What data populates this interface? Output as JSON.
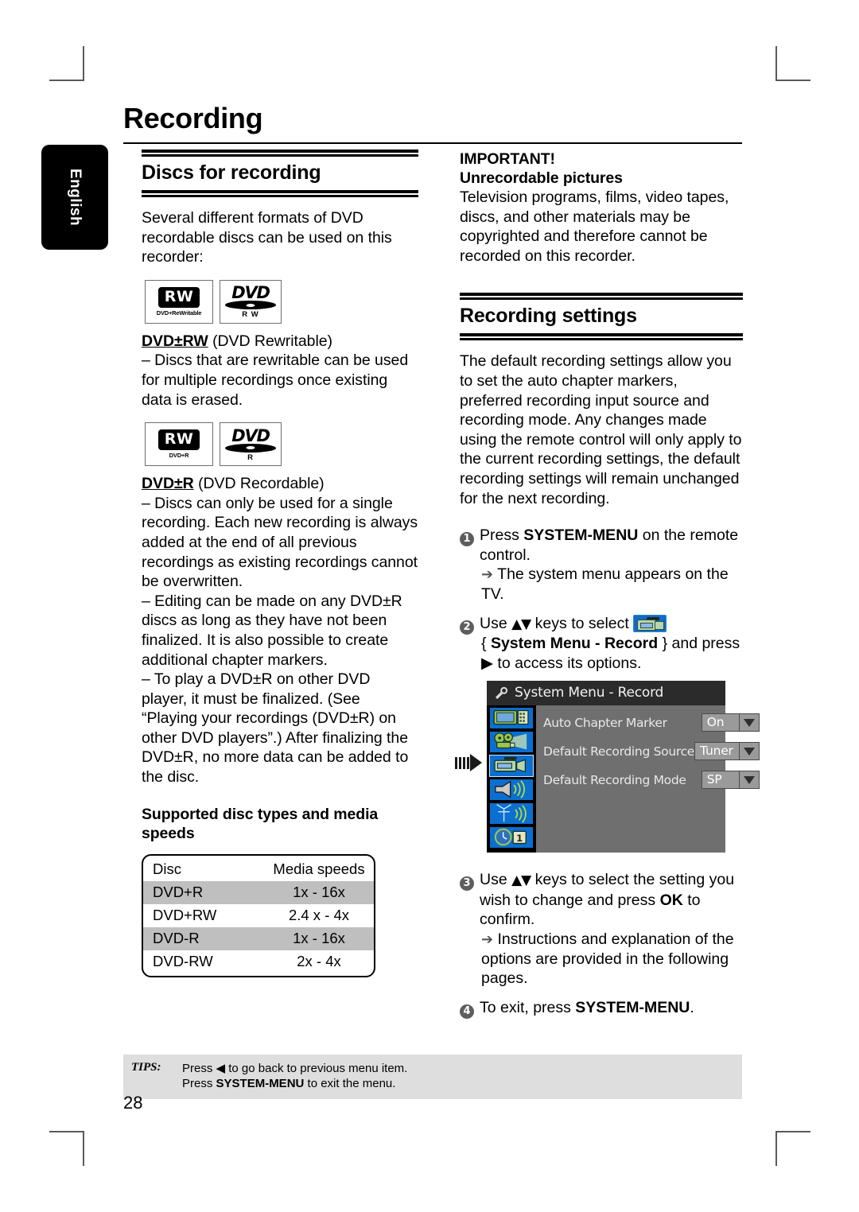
{
  "page": {
    "title": "Recording",
    "language_tab": "English",
    "page_number": "28"
  },
  "left_column": {
    "section_heading": "Discs for recording",
    "intro": "Several different formats of DVD recordable discs can be used on this recorder:",
    "logos_rw": {
      "mark": "RW",
      "caption_rewritable": "DVD+ReWritable",
      "caption_recordable": "DVD+R",
      "dvd_word": "DVD",
      "sub_rw": "R  W",
      "sub_r": "R",
      "tm": "™"
    },
    "dvd_rw_term": "DVD±RW",
    "dvd_rw_term_suffix": " (DVD Rewritable)",
    "dvd_rw_body": "– Discs that are rewritable can be used for multiple recordings once existing data is erased.",
    "dvd_r_term": "DVD±R",
    "dvd_r_term_suffix": " (DVD Recordable)",
    "dvd_r_body_1": "– Discs can only be used for a single recording. Each new recording is always added at the end of all previous recordings as existing recordings cannot be overwritten.",
    "dvd_r_body_2": "– Editing can be made on any DVD±R discs as long as they have not been finalized. It is also possible to create additional chapter markers.",
    "dvd_r_body_3": "– To play a DVD±R on other DVD player, it must be finalized. (See “Playing your recordings (DVD±R) on other DVD players”.) After finalizing the DVD±R, no more data can be added to the disc.",
    "table_heading": "Supported disc types and media speeds",
    "table": {
      "columns": [
        "Disc",
        "Media speeds"
      ],
      "rows": [
        [
          "DVD+R",
          "1x - 16x"
        ],
        [
          "DVD+RW",
          "2.4 x - 4x"
        ],
        [
          "DVD-R",
          "1x - 16x"
        ],
        [
          "DVD-RW",
          "2x - 4x"
        ]
      ]
    }
  },
  "right_column": {
    "important_title": "IMPORTANT!",
    "important_subtitle": "Unrecordable pictures",
    "important_body": "Television programs, films, video tapes, discs, and other materials may be copyrighted and therefore cannot be recorded on this recorder.",
    "section_heading": "Recording settings",
    "settings_intro": "The default recording settings allow you to set the auto chapter markers, preferred recording input source and recording mode. Any changes made using the remote control will only apply to the current recording settings, the default recording settings will remain unchanged for the next recording.",
    "steps": [
      {
        "num": "1",
        "line_pre": "Press ",
        "line_bold": "SYSTEM-MENU",
        "line_post": " on the remote control.",
        "result": "The system menu appears on the TV."
      },
      {
        "num": "2",
        "line_pre": "Use ",
        "keys": "▲▼",
        "line_mid": " keys to select ",
        "brace_open": "{ ",
        "menu_name": "System Menu - Record",
        "brace_close": " } and press",
        "line_post": "▶ to access its options."
      },
      {
        "num": "3",
        "line_pre": "Use ",
        "keys": "▲▼",
        "line_mid": " keys to select the setting you wish to change and press ",
        "line_bold": "OK",
        "line_post": " to confirm.",
        "result": "Instructions and explanation of the options are provided in the following pages."
      },
      {
        "num": "4",
        "line_pre": "To exit, press ",
        "line_bold": "SYSTEM-MENU",
        "line_post": "."
      }
    ]
  },
  "osd_menu": {
    "title": "System Menu - Record",
    "rows": [
      {
        "label": "Auto Chapter Marker",
        "value": "On"
      },
      {
        "label": "Default Recording Source",
        "value": "Tuner"
      },
      {
        "label": "Default Recording Mode",
        "value": "SP"
      }
    ],
    "icons": [
      "tv-monitor-icon",
      "film-projector-icon",
      "camcorder-record-icon",
      "speaker-sound-icon",
      "antenna-installation-icon",
      "clock-timer-icon"
    ],
    "selected_icon_index": 2
  },
  "tips": {
    "label": "TIPS:",
    "line1_pre": "Press ",
    "line1_glyph": "◀",
    "line1_post": " to go back to previous menu item.",
    "line2_pre": "Press ",
    "line2_bold": "SYSTEM-MENU",
    "line2_post": " to exit the menu."
  },
  "colors": {
    "osd_blue": "#0b6fd0",
    "osd_title_bar": "#2b2b2b",
    "osd_panel": "#6f6f6f",
    "tips_bg": "#dedede",
    "table_alt_row": "#bfbfbf"
  }
}
